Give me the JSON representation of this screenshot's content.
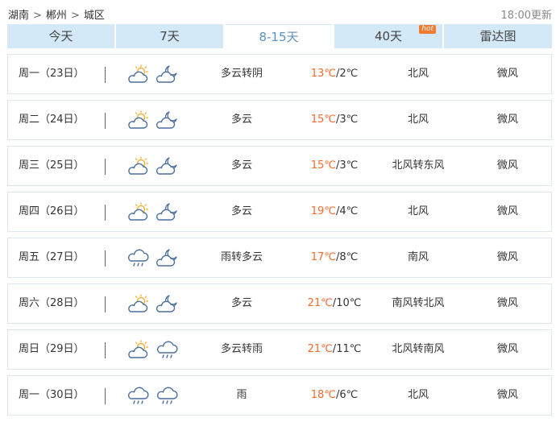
{
  "breadcrumb": {
    "province": "湖南",
    "city": "郴州",
    "district": "城区",
    "separator": ">"
  },
  "update_time": "18:00更新",
  "tabs": [
    {
      "label": "今天",
      "active": false
    },
    {
      "label": "7天",
      "active": false
    },
    {
      "label": "8-15天",
      "active": true
    },
    {
      "label": "40天",
      "active": false,
      "badge": "hot"
    },
    {
      "label": "雷达图",
      "active": false
    }
  ],
  "colors": {
    "tab_bg": "#d4e9f7",
    "tab_active_text": "#5f8fc0",
    "high_temp": "#f46a2b",
    "hot_badge": "#f47a30",
    "icon_stroke": "#4a6fa0",
    "sun": "#f5a623"
  },
  "forecast": [
    {
      "day": "周一（23日）",
      "icon_day": "partly-cloudy-day-icon",
      "icon_night": "partly-cloudy-night-icon",
      "weather": "多云转阴",
      "high": "13℃",
      "sep": "/",
      "low": "2℃",
      "wind_dir": "北风",
      "wind_level": "微风"
    },
    {
      "day": "周二（24日）",
      "icon_day": "partly-cloudy-day-icon",
      "icon_night": "partly-cloudy-night-icon",
      "weather": "多云",
      "high": "15℃",
      "sep": "/",
      "low": "3℃",
      "wind_dir": "北风",
      "wind_level": "微风"
    },
    {
      "day": "周三（25日）",
      "icon_day": "partly-cloudy-day-icon",
      "icon_night": "partly-cloudy-night-icon",
      "weather": "多云",
      "high": "15℃",
      "sep": "/",
      "low": "3℃",
      "wind_dir": "北风转东风",
      "wind_level": "微风"
    },
    {
      "day": "周四（26日）",
      "icon_day": "partly-cloudy-day-icon",
      "icon_night": "partly-cloudy-night-icon",
      "weather": "多云",
      "high": "19℃",
      "sep": "/",
      "low": "4℃",
      "wind_dir": "北风",
      "wind_level": "微风"
    },
    {
      "day": "周五（27日）",
      "icon_day": "rain-icon",
      "icon_night": "partly-cloudy-night-icon",
      "weather": "雨转多云",
      "high": "17℃",
      "sep": "/",
      "low": "8℃",
      "wind_dir": "南风",
      "wind_level": "微风"
    },
    {
      "day": "周六（28日）",
      "icon_day": "partly-cloudy-day-icon",
      "icon_night": "partly-cloudy-night-icon",
      "weather": "多云",
      "high": "21℃",
      "sep": "/",
      "low": "10℃",
      "wind_dir": "南风转北风",
      "wind_level": "微风"
    },
    {
      "day": "周日（29日）",
      "icon_day": "partly-cloudy-day-icon",
      "icon_night": "rain-icon",
      "weather": "多云转雨",
      "high": "21℃",
      "sep": "/",
      "low": "11℃",
      "wind_dir": "北风转南风",
      "wind_level": "微风"
    },
    {
      "day": "周一（30日）",
      "icon_day": "rain-icon",
      "icon_night": "rain-icon",
      "weather": "雨",
      "high": "18℃",
      "sep": "/",
      "low": "6℃",
      "wind_dir": "北风",
      "wind_level": "微风"
    }
  ]
}
